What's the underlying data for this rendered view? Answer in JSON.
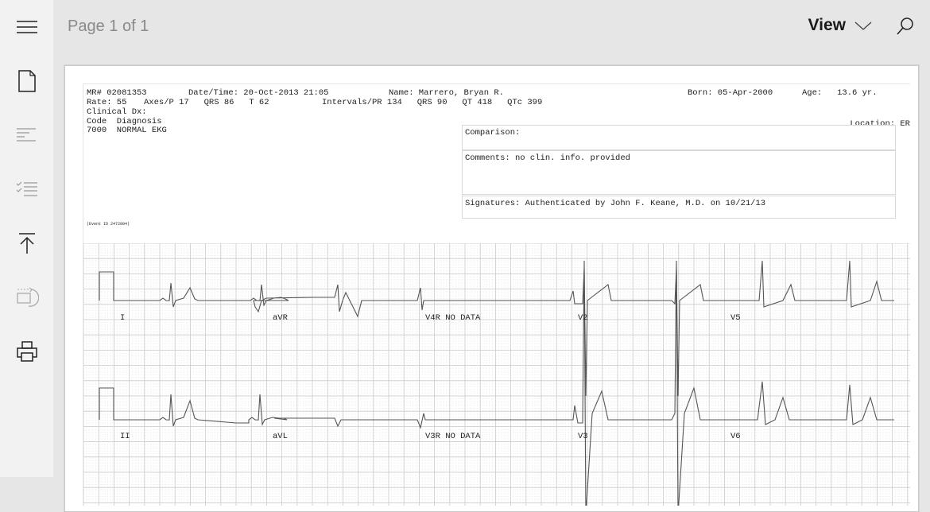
{
  "app": {
    "menu_icon": "hamburger-menu-icon",
    "page_indicator": "Page 1 of 1",
    "view_label": "View",
    "view_icon": "chevron-down-icon",
    "search_icon": "search-icon"
  },
  "sidebar": {
    "items": [
      {
        "name": "page-view",
        "icon": "document-icon"
      },
      {
        "name": "text-alignment",
        "icon": "align-lines-icon"
      },
      {
        "name": "list-view",
        "icon": "checklist-icon"
      },
      {
        "name": "go-to-top",
        "icon": "arrow-up-to-line-icon"
      },
      {
        "name": "rotate",
        "icon": "rotate-page-icon"
      },
      {
        "name": "print",
        "icon": "printer-icon"
      }
    ]
  },
  "report": {
    "mr": "MR# 02081353",
    "datetime": "Date/Time: 20-Oct-2013 21:05",
    "name": "Name: Marrero, Bryan R.",
    "born": "Born: 05-Apr-2000",
    "age": "Age:   13.6 yr.",
    "rate": "Rate: 55",
    "axes": "Axes/P 17   QRS 86   T 62",
    "intervals": "Intervals/PR 134   QRS 90   QT 418   QTc 399",
    "clinical_dx": "Clinical Dx:",
    "code_header": "Code  Diagnosis",
    "code_row": "7000  NORMAL EKG",
    "location": "Location: ER",
    "comparison": "Comparison:",
    "comments": "Comments: no clin. info. provided",
    "signatures": "Signatures: Authenticated by John F. Keane, M.D. on 10/21/13",
    "event_id": "(Event ID 2472804)"
  },
  "ecg": {
    "grid_color": "#c9c9c9",
    "trace_color": "#555555",
    "rows": [
      {
        "leads": [
          "I",
          "aVR",
          "V4R NO DATA",
          "V2",
          "V5"
        ]
      },
      {
        "leads": [
          "II",
          "aVL",
          "V3R NO DATA",
          "V3",
          "V6"
        ]
      }
    ]
  }
}
